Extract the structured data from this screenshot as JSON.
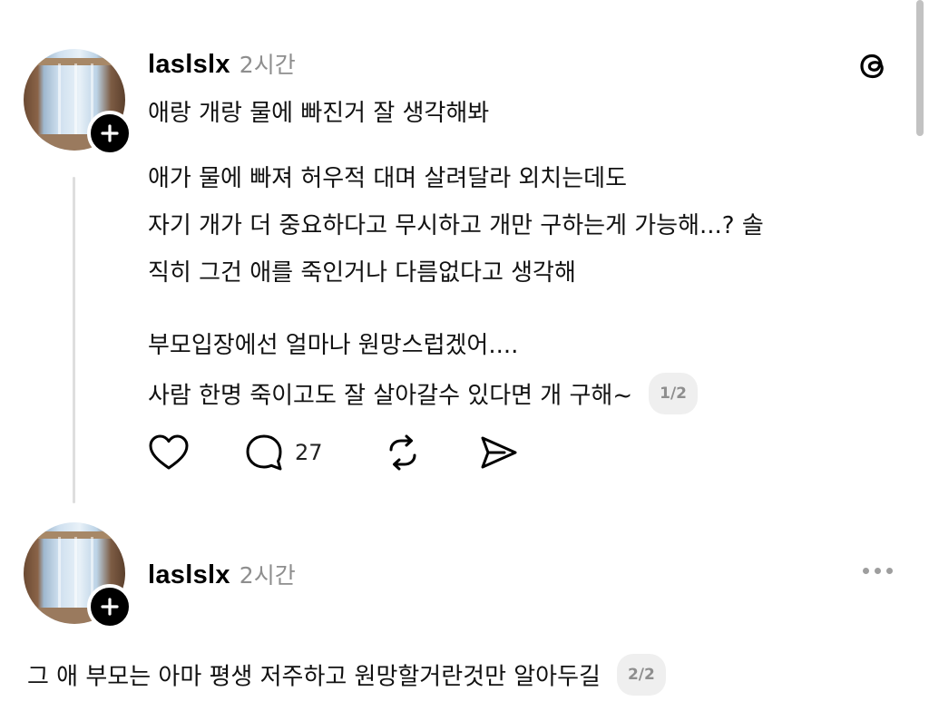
{
  "posts": [
    {
      "username": "laslslx",
      "time": "2시간",
      "lines": [
        "애랑 개랑 물에 빠진거 잘 생각해봐",
        "애가 물에 빠져 허우적 대며 살려달라 외치는데도",
        "자기 개가 더 중요하다고 무시하고 개만 구하는게 가능해...? 솔",
        "직히 그건 애를 죽인거나 다름없다고 생각해",
        "부모입장에선 얼마나 원망스럽겠어....",
        "사람 한명 죽이고도 잘 살아갈수 있다면 개 구해~"
      ],
      "page_badge": "1/2",
      "actions": {
        "like_icon": "heart-icon",
        "reply_icon": "comment-icon",
        "reply_count": "27",
        "repost_icon": "repost-icon",
        "share_icon": "send-icon"
      },
      "corner_icon": "threads-logo-icon"
    },
    {
      "username": "laslslx",
      "time": "2시간",
      "lines": [
        "그 애 부모는 아마 평생 저주하고 원망할거란것만 알아두길"
      ],
      "page_badge": "2/2",
      "corner_icon": "more-icon"
    }
  ],
  "colors": {
    "text": "#111111",
    "muted": "#8e8e8e",
    "badge_bg": "#efefef",
    "thread_line": "#dedede"
  }
}
